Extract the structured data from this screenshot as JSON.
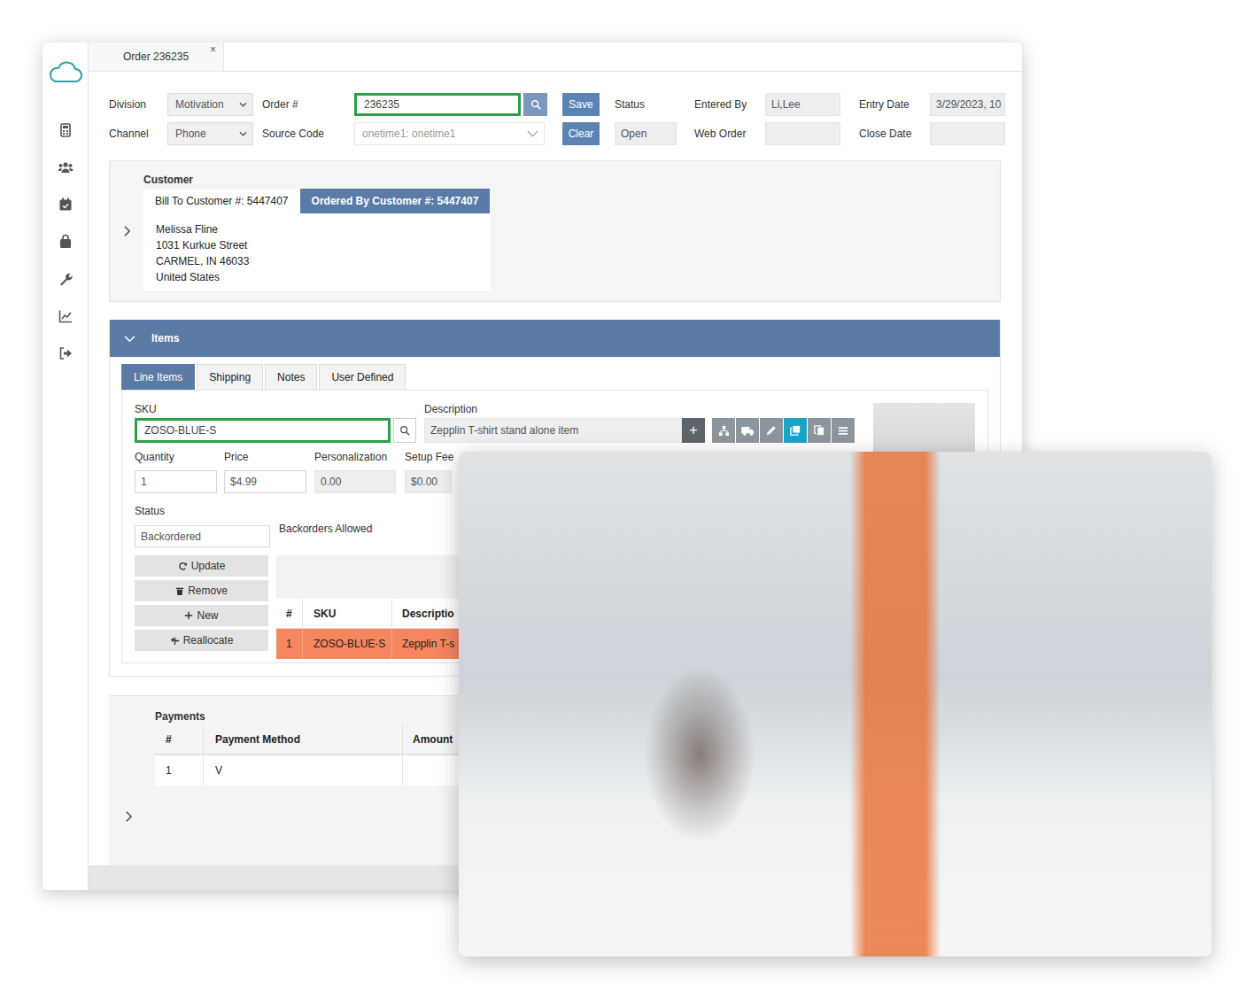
{
  "window": {
    "tab": {
      "label": "Order 236235",
      "close": "×"
    }
  },
  "header": {
    "division": {
      "label": "Division",
      "value": "Motivation"
    },
    "channel": {
      "label": "Channel",
      "value": "Phone"
    },
    "order": {
      "label": "Order #",
      "value": "236235",
      "highlighted": true
    },
    "source_code": {
      "label": "Source Code",
      "value": "onetime1: onetime1",
      "disabled": true
    },
    "save": "Save",
    "clear": "Clear",
    "status": {
      "label": "Status",
      "value": "Open"
    },
    "entered_by": {
      "label": "Entered By",
      "value": "Li,Lee"
    },
    "web_order": {
      "label": "Web Order",
      "value": ""
    },
    "entry_date": {
      "label": "Entry Date",
      "value": "3/29/2023, 10"
    },
    "close_date": {
      "label": "Close Date",
      "value": ""
    }
  },
  "customer": {
    "title": "Customer",
    "expanded": false,
    "tabs": [
      {
        "label": "Bill To Customer #: 5447407",
        "selected": false
      },
      {
        "label": "Ordered By Customer #: 5447407",
        "selected": true
      }
    ],
    "address": [
      "Melissa Fline",
      "1031 Kurkue Street",
      "CARMEL, IN 46033",
      "United States"
    ]
  },
  "items": {
    "title": "Items",
    "expanded": true,
    "tabs": [
      {
        "label": "Line Items",
        "selected": true
      },
      {
        "label": "Shipping",
        "selected": false
      },
      {
        "label": "Notes",
        "selected": false
      },
      {
        "label": "User Defined",
        "selected": false
      }
    ],
    "sku": {
      "label": "SKU",
      "value": "ZOSO-BLUE-S",
      "highlighted": true
    },
    "description": {
      "label": "Description",
      "value": "Zepplin T-shirt stand alone item",
      "add": "+"
    },
    "toolbar": [
      {
        "selected": false
      },
      {
        "selected": false
      },
      {
        "selected": false
      },
      {
        "selected": true
      },
      {
        "selected": false
      },
      {
        "selected": false
      }
    ],
    "fields": [
      {
        "label": "Quantity",
        "value": "1",
        "disabled": false
      },
      {
        "label": "Price",
        "value": "$4.99",
        "disabled": false
      },
      {
        "label": "Personalization",
        "value": "0.00",
        "disabled": true
      },
      {
        "label": "Setup Fee",
        "value": "$0.00",
        "disabled": true
      }
    ],
    "status": {
      "label": "Status",
      "value": "Backordered"
    },
    "backorders": "Backorders Allowed",
    "actions": [
      "Update",
      "Remove",
      "New",
      "Reallocate"
    ],
    "table": {
      "columns": [
        "#",
        "SKU",
        "Descriptio"
      ],
      "rows": [
        {
          "cells": [
            "1",
            "ZOSO-BLUE-S",
            "Zepplin T-s"
          ],
          "selected": true
        }
      ]
    }
  },
  "payments": {
    "title": "Payments",
    "expanded": false,
    "columns": [
      "#",
      "Payment Method",
      "Amount"
    ],
    "rows": [
      {
        "cells": [
          "1",
          "V"
        ]
      }
    ]
  }
}
